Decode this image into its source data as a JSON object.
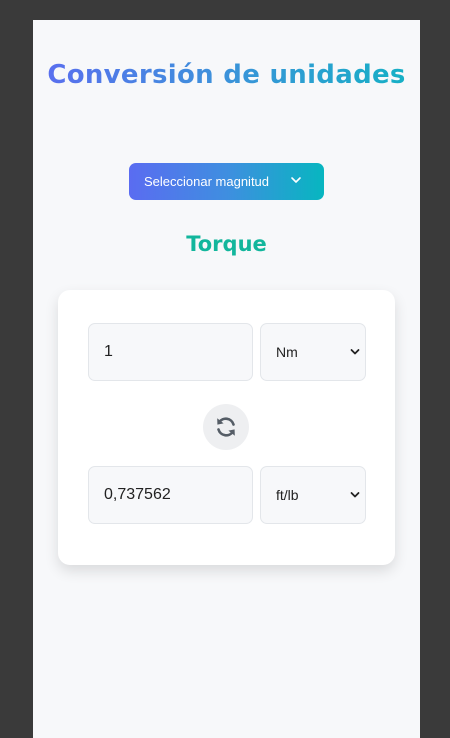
{
  "header": {
    "title": "Conversión de unidades"
  },
  "magnitude_select": {
    "label": "Seleccionar magnitud",
    "icon": "chevron-down-icon"
  },
  "current_magnitude": "Torque",
  "converter": {
    "input_value": "1",
    "input_unit": "Nm",
    "output_value": "0,737562",
    "output_unit": "ft/lb",
    "swap_icon": "refresh-icon"
  },
  "colors": {
    "accent_start": "#5a6cf1",
    "accent_end": "#07b6c0",
    "magnitude_color": "#12b69c"
  }
}
